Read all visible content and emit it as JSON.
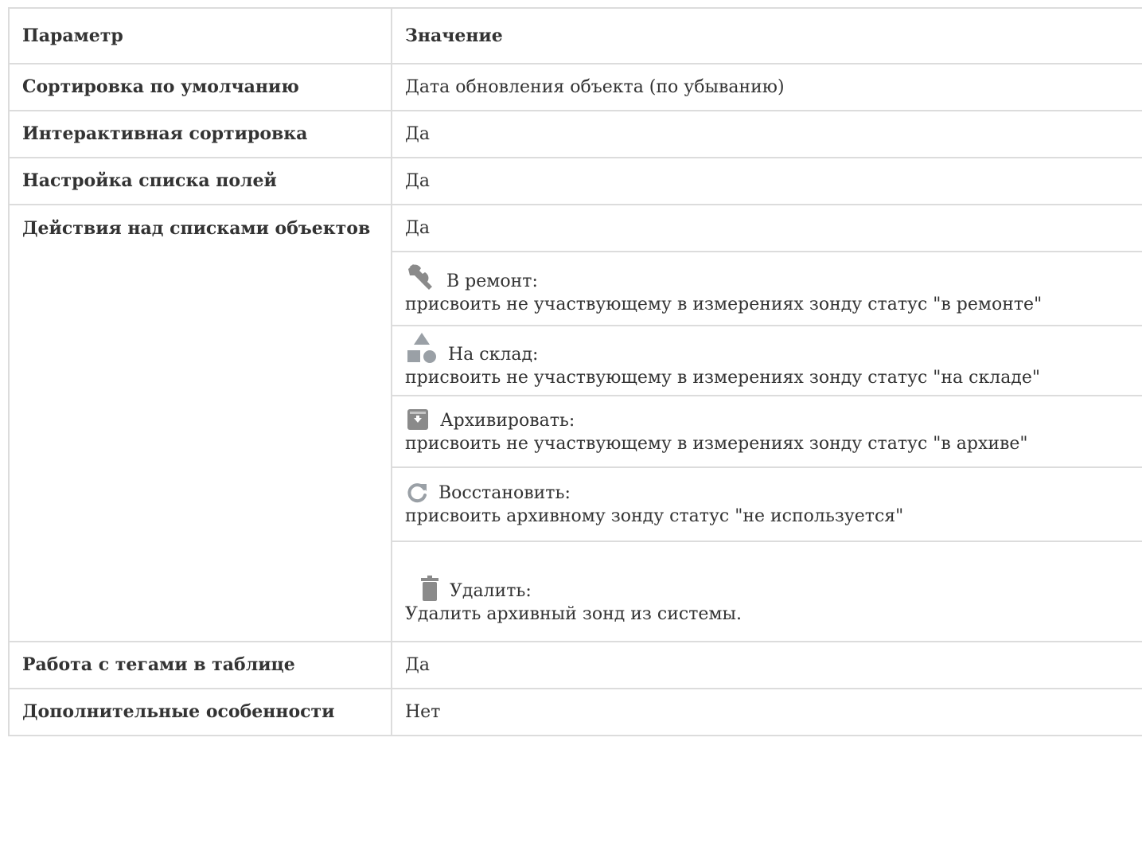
{
  "table": {
    "header": {
      "param": "Параметр",
      "value": "Значение"
    },
    "rows_top": [
      {
        "param": "Сортировка по умолчанию",
        "value": "Дата обновления объекта (по убыванию)"
      },
      {
        "param": "Интерактивная сортировка",
        "value": "Да"
      },
      {
        "param": "Настройка списка полей",
        "value": "Да"
      }
    ],
    "actions_row": {
      "param": "Действия над списками объектов",
      "value": "Да",
      "actions": [
        {
          "icon": "wrench-icon",
          "title": "В ремонт:",
          "desc": "присвоить не участвующему в измерениях зонду статус  \"в ремонте\""
        },
        {
          "icon": "shapes-icon",
          "title": "На склад:",
          "desc": "присвоить не участвующему в измерениях зонду статус  \"на складе\""
        },
        {
          "icon": "archive-icon",
          "title": "Архивировать:",
          "desc": "присвоить не участвующему в измерениях зонду статус  \"в архиве\""
        },
        {
          "icon": "refresh-icon",
          "title": "Восстановить:",
          "desc": "присвоить архивному зонду статус  \"не используется\""
        },
        {
          "icon": "trash-icon",
          "title": "Удалить:",
          "desc": "Удалить архивный зонд из системы."
        }
      ]
    },
    "rows_bottom": [
      {
        "param": "Работа с тегами в таблице",
        "value": "Да"
      },
      {
        "param": "Дополнительные особенности",
        "value": "Нет"
      }
    ]
  },
  "colors": {
    "border": "#dcdcdc",
    "text": "#333333",
    "icon": "#8a8a8a"
  }
}
